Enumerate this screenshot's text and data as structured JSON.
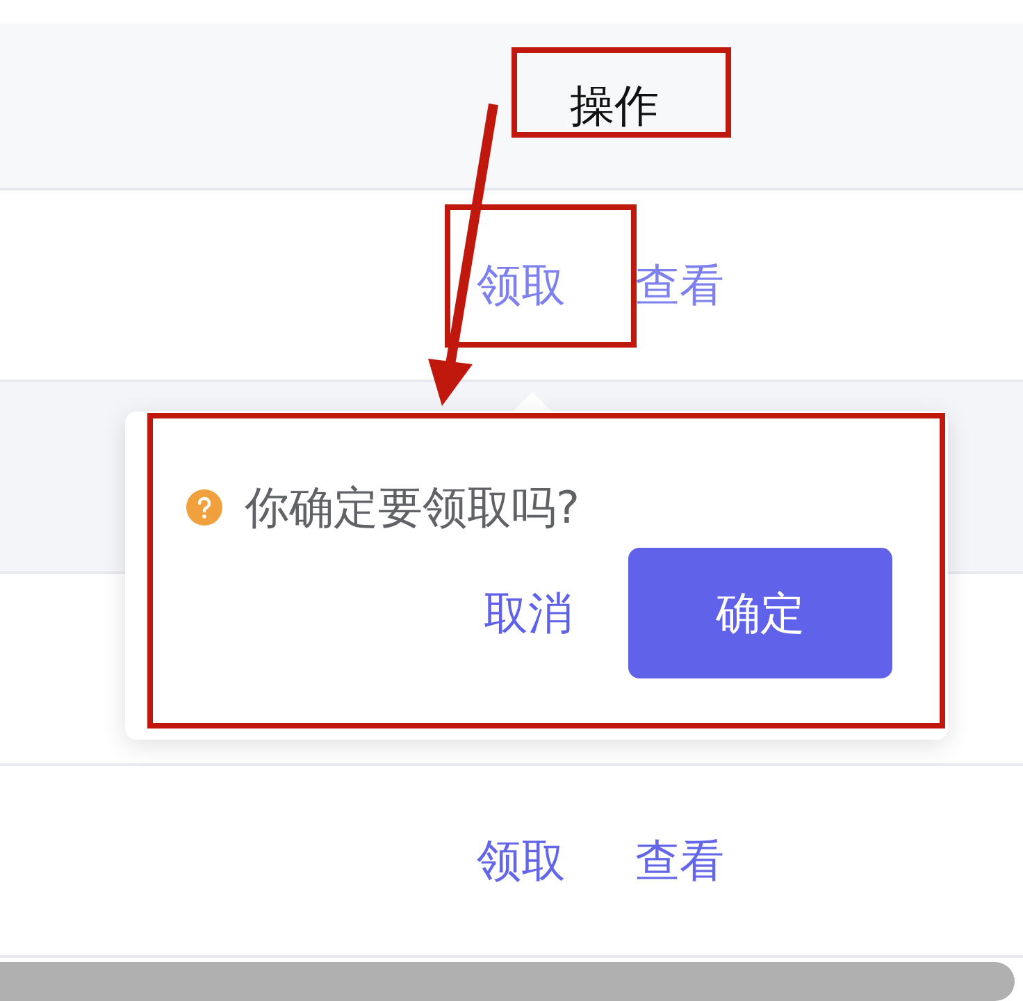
{
  "table": {
    "columns": [
      {
        "label": "操作"
      }
    ],
    "rows": [
      {
        "actions": [
          "领取",
          "查看"
        ]
      },
      {
        "actions": [
          "领取",
          "查看"
        ]
      }
    ]
  },
  "popconfirm": {
    "message": "你确定要领取吗?",
    "cancel": "取消",
    "confirm": "确定"
  }
}
